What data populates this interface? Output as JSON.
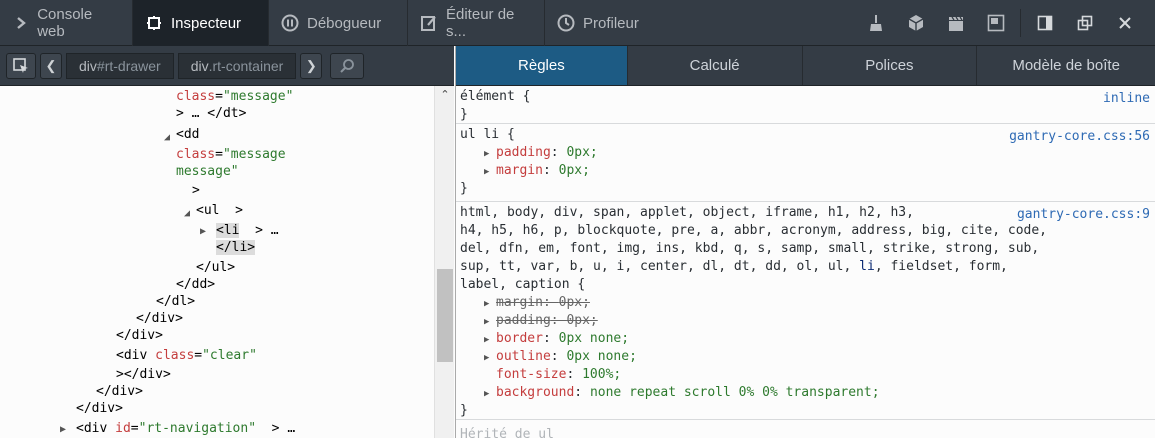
{
  "toolbar": {
    "tabs": [
      {
        "label": "Console web"
      },
      {
        "label": "Inspecteur"
      },
      {
        "label": "Débogueur"
      },
      {
        "label": "Éditeur de s..."
      },
      {
        "label": "Profileur"
      }
    ],
    "right_icons": [
      "broom-icon",
      "cube-icon",
      "clapperboard-icon",
      "window-icon",
      "split-pane-icon",
      "undock-icon",
      "close-icon"
    ]
  },
  "breadcrumb": {
    "items": [
      {
        "tag": "div",
        "attr": "#rt-drawer"
      },
      {
        "tag": "div",
        "attr": ".rt-container"
      }
    ]
  },
  "markup": {
    "l1_attr": "class",
    "l1_val": "\"message\"",
    "l2": "> … </dt>",
    "l3_tag": "<dd",
    "l4_attr": "class",
    "l4_val": "\"message",
    "l5_val": "message\"",
    "l6": ">",
    "l7_tag": "<ul",
    "l7_rest": "  >",
    "l8_tag": "<li",
    "l8_rest": "  > …",
    "l9_tag": "</li>",
    "l10": "</ul>",
    "l11": "</dd>",
    "l12": "</dl>",
    "l13": "</div>",
    "l14": "</div>",
    "l15_tag": "<div ",
    "l15_attr": "class",
    "l15_val": "\"clear\"",
    "l16": "></div>",
    "l17": "</div>",
    "l18": "</div>",
    "l19_tag": "<div ",
    "l19_attr": "id",
    "l19_val": "\"rt-navigation\"",
    "l19_rest": "  > …"
  },
  "rules_tabs": [
    "Règles",
    "Calculé",
    "Polices",
    "Modèle de boîte"
  ],
  "rules": {
    "r1_selector": "élément {",
    "r1_source": "inline",
    "r1_close": "}",
    "r2_selector": "ul li {",
    "r2_source": "gantry-core.css:56",
    "r2_p1_name": "padding",
    "r2_p1_value": "0px;",
    "r2_p2_name": "margin",
    "r2_p2_value": "0px;",
    "r2_close": "}",
    "r3_source": "gantry-core.css:9",
    "r3_sel_1": "html, body, div, span, applet, object, iframe, h1, h2, h3,",
    "r3_sel_2": "h4, h5, h6, p, blockquote, pre, a, abbr, acronym, address, big, cite, code,",
    "r3_sel_3": "del, dfn, em, font, img, ins, kbd, q, s, samp, small, strike, strong, sub,",
    "r3_sel_4a": "sup, tt, var, b, u, i, center, dl, dt, dd, ol, ul, ",
    "r3_sel_4b": "li",
    "r3_sel_4c": ", fieldset, form,",
    "r3_sel_5": "label, caption {",
    "r3_p1_name": "margin",
    "r3_p1_value": "0px;",
    "r3_p2_name": "padding",
    "r3_p2_value": "0px;",
    "r3_p3_name": "border",
    "r3_p3_value": "0px none;",
    "r3_p4_name": "outline",
    "r3_p4_value": "0px none;",
    "r3_p5_name": "font-size",
    "r3_p5_value": "100%;",
    "r3_p6_name": "background",
    "r3_p6_value": "none repeat scroll 0% 0% transparent;",
    "r3_close": "}",
    "r4_partial": "Hérité de ul"
  }
}
